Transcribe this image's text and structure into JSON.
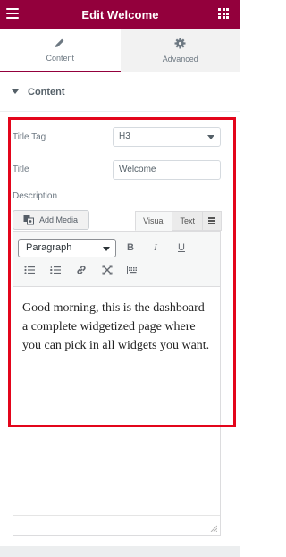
{
  "header": {
    "title": "Edit Welcome",
    "menu_icon": "hamburger-icon",
    "apps_icon": "grid-icon",
    "background": "#93003c"
  },
  "tabs": [
    {
      "label": "Content",
      "icon": "pencil-icon",
      "active": true
    },
    {
      "label": "Advanced",
      "icon": "gear-icon",
      "active": false
    }
  ],
  "section": {
    "title": "Content",
    "expanded": true
  },
  "fields": {
    "title_tag": {
      "label": "Title Tag",
      "value": "H3"
    },
    "title": {
      "label": "Title",
      "value": "Welcome"
    },
    "description": {
      "label": "Description"
    }
  },
  "editor": {
    "add_media_label": "Add Media",
    "mode_tabs": [
      {
        "label": "Visual",
        "active": true
      },
      {
        "label": "Text",
        "active": false
      }
    ],
    "format_select": "Paragraph",
    "toolbar_icons": [
      "bold-icon",
      "italic-icon",
      "underline-icon",
      "bullet-list-icon",
      "numbered-list-icon",
      "link-icon",
      "fullscreen-icon",
      "keyboard-icon"
    ],
    "bold_label": "B",
    "italic_label": "I",
    "underline_label": "U",
    "content": "Good morning, this is the dashboard a complete widgetized page where you can pick in all widgets you want."
  },
  "highlight_color": "#e3051b"
}
